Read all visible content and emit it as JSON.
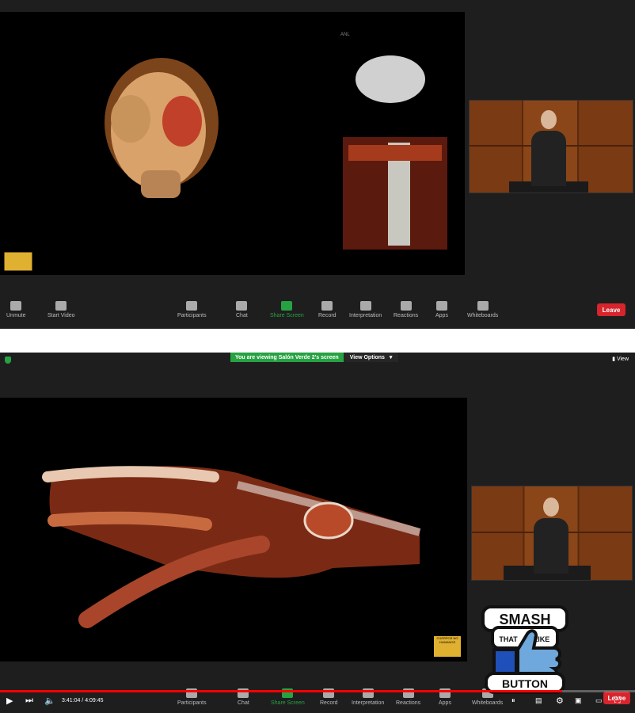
{
  "top_toolbar": {
    "items": [
      {
        "label": "Unmute",
        "icon": "mic-icon"
      },
      {
        "label": "Start Video",
        "icon": "video-icon"
      },
      {
        "label": "Participants",
        "icon": "participants-icon"
      },
      {
        "label": "Chat",
        "icon": "chat-icon"
      },
      {
        "label": "Share Screen",
        "icon": "share-screen-icon"
      },
      {
        "label": "Record",
        "icon": "record-icon"
      },
      {
        "label": "Interpretation",
        "icon": "globe-icon"
      },
      {
        "label": "Reactions",
        "icon": "reactions-icon"
      },
      {
        "label": "Apps",
        "icon": "apps-icon"
      },
      {
        "label": "Whiteboards",
        "icon": "whiteboard-icon"
      }
    ],
    "leave_label": "Leave"
  },
  "banner": {
    "viewing_text": "You are viewing Salón Verde 2's screen",
    "view_options": "View Options",
    "view": "View"
  },
  "bottom_toolbar": {
    "items": [
      {
        "label": "Participants",
        "icon": "participants-icon"
      },
      {
        "label": "Chat",
        "icon": "chat-icon"
      },
      {
        "label": "Share Screen",
        "icon": "share-screen-icon"
      },
      {
        "label": "Record",
        "icon": "record-icon"
      },
      {
        "label": "Interpretation",
        "icon": "globe-icon"
      },
      {
        "label": "Reactions",
        "icon": "reactions-icon"
      },
      {
        "label": "Apps",
        "icon": "apps-icon"
      },
      {
        "label": "Whiteboards",
        "icon": "whiteboard-icon"
      }
    ],
    "leave_label": "Leave"
  },
  "badge": {
    "text": "CUERPOS NO HUMANOS"
  },
  "player": {
    "current_time": "3:41:04",
    "separator": " / ",
    "duration": "4:09:45",
    "progress_fraction": 0.885
  },
  "sticker": {
    "line1": "SMASH",
    "line2": "THAT",
    "line3": "LIKE",
    "line4": "BUTTON"
  },
  "colors": {
    "zoom_green": "#27a243",
    "leave_red": "#d6252d",
    "progress_red": "#ff0000"
  }
}
